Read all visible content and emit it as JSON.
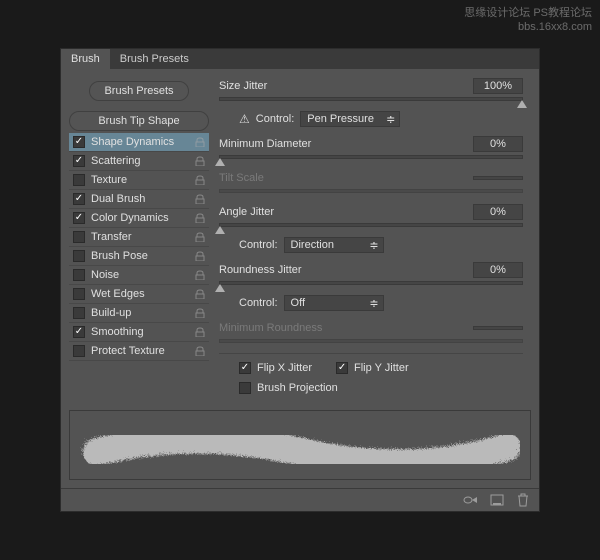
{
  "tabs": {
    "brush": "Brush",
    "presets": "Brush Presets"
  },
  "buttons": {
    "presets": "Brush Presets",
    "tipShape": "Brush Tip Shape"
  },
  "options": [
    {
      "label": "Shape Dynamics",
      "checked": true,
      "selected": true,
      "lock": true
    },
    {
      "label": "Scattering",
      "checked": true,
      "selected": false,
      "lock": true
    },
    {
      "label": "Texture",
      "checked": false,
      "selected": false,
      "lock": true
    },
    {
      "label": "Dual Brush",
      "checked": true,
      "selected": false,
      "lock": true
    },
    {
      "label": "Color Dynamics",
      "checked": true,
      "selected": false,
      "lock": true
    },
    {
      "label": "Transfer",
      "checked": false,
      "selected": false,
      "lock": true
    },
    {
      "label": "Brush Pose",
      "checked": false,
      "selected": false,
      "lock": true
    },
    {
      "label": "Noise",
      "checked": false,
      "selected": false,
      "lock": true
    },
    {
      "label": "Wet Edges",
      "checked": false,
      "selected": false,
      "lock": true
    },
    {
      "label": "Build-up",
      "checked": false,
      "selected": false,
      "lock": true
    },
    {
      "label": "Smoothing",
      "checked": true,
      "selected": false,
      "lock": true
    },
    {
      "label": "Protect Texture",
      "checked": false,
      "selected": false,
      "lock": true
    }
  ],
  "settings": {
    "sizeJitter": {
      "label": "Size Jitter",
      "value": "100%"
    },
    "control1": {
      "label": "Control:",
      "value": "Pen Pressure",
      "warning": true
    },
    "minDiameter": {
      "label": "Minimum Diameter",
      "value": "0%"
    },
    "tiltScale": {
      "label": "Tilt Scale",
      "value": ""
    },
    "angleJitter": {
      "label": "Angle Jitter",
      "value": "0%"
    },
    "control2": {
      "label": "Control:",
      "value": "Direction"
    },
    "roundnessJitter": {
      "label": "Roundness Jitter",
      "value": "0%"
    },
    "control3": {
      "label": "Control:",
      "value": "Off"
    },
    "minRoundness": {
      "label": "Minimum Roundness",
      "value": ""
    },
    "flipX": {
      "label": "Flip X Jitter",
      "checked": true
    },
    "flipY": {
      "label": "Flip Y Jitter",
      "checked": true
    },
    "brushProjection": {
      "label": "Brush Projection",
      "checked": false
    }
  },
  "watermark": {
    "line1": "思缘设计论坛    PS教程论坛",
    "line2": "bbs.16xx8.com"
  }
}
